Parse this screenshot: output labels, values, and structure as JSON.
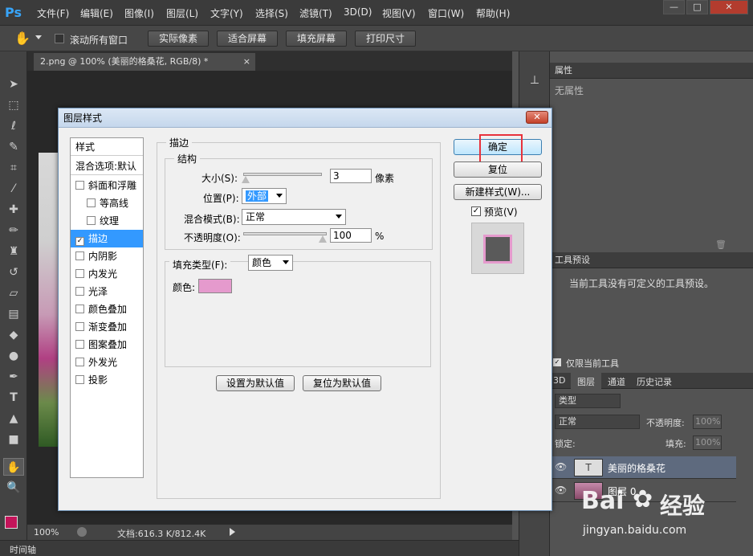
{
  "app": {
    "logo": "Ps"
  },
  "menu": [
    "文件(F)",
    "编辑(E)",
    "图像(I)",
    "图层(L)",
    "文字(Y)",
    "选择(S)",
    "滤镜(T)",
    "3D(D)",
    "视图(V)",
    "窗口(W)",
    "帮助(H)"
  ],
  "window_controls": [
    "—",
    "□",
    "✕"
  ],
  "options": {
    "scroll_all": "滚动所有窗口",
    "btn_actual": "实际像素",
    "btn_fit": "适合屏幕",
    "btn_fill": "填充屏幕",
    "btn_print": "打印尺寸"
  },
  "document": {
    "tab": "2.png @ 100% (美丽的格桑花, RGB/8) *",
    "close": "×"
  },
  "status": {
    "zoom": "100%",
    "doc": "文档:616.3 K/812.4K"
  },
  "timeline": "时间轴",
  "panels": {
    "properties": {
      "title": "属性",
      "content": "无属性"
    },
    "tool_presets": {
      "title": "工具预设",
      "content": "当前工具没有可定义的工具预设。",
      "current_only": "仅限当前工具"
    },
    "layers": {
      "tabs": [
        "3D",
        "图层",
        "通道",
        "历史记录"
      ],
      "filter": "类型",
      "blend": "正常",
      "opacity_label": "不透明度:",
      "opacity": "100%",
      "lock_label": "锁定:",
      "fill_label": "填充:",
      "fill": "100%",
      "items": [
        {
          "name": "美丽的格桑花",
          "thumb": "T"
        },
        {
          "name": "图层 0",
          "thumb": ""
        }
      ]
    }
  },
  "dialog": {
    "title": "图层样式",
    "close": "✕",
    "styles": [
      {
        "label": "样式",
        "checkbox": false,
        "checked": false,
        "indent": false,
        "selected": false
      },
      {
        "label": "混合选项:默认",
        "checkbox": false,
        "checked": false,
        "indent": false,
        "selected": false
      },
      {
        "label": "斜面和浮雕",
        "checkbox": true,
        "checked": false,
        "indent": false,
        "selected": false
      },
      {
        "label": "等高线",
        "checkbox": true,
        "checked": false,
        "indent": true,
        "selected": false
      },
      {
        "label": "纹理",
        "checkbox": true,
        "checked": false,
        "indent": true,
        "selected": false
      },
      {
        "label": "描边",
        "checkbox": true,
        "checked": true,
        "indent": false,
        "selected": true
      },
      {
        "label": "内阴影",
        "checkbox": true,
        "checked": false,
        "indent": false,
        "selected": false
      },
      {
        "label": "内发光",
        "checkbox": true,
        "checked": false,
        "indent": false,
        "selected": false
      },
      {
        "label": "光泽",
        "checkbox": true,
        "checked": false,
        "indent": false,
        "selected": false
      },
      {
        "label": "颜色叠加",
        "checkbox": true,
        "checked": false,
        "indent": false,
        "selected": false
      },
      {
        "label": "渐变叠加",
        "checkbox": true,
        "checked": false,
        "indent": false,
        "selected": false
      },
      {
        "label": "图案叠加",
        "checkbox": true,
        "checked": false,
        "indent": false,
        "selected": false
      },
      {
        "label": "外发光",
        "checkbox": true,
        "checked": false,
        "indent": false,
        "selected": false
      },
      {
        "label": "投影",
        "checkbox": true,
        "checked": false,
        "indent": false,
        "selected": false
      }
    ],
    "stroke": {
      "section": "描边",
      "structure": "结构",
      "size_label": "大小(S):",
      "size": "3",
      "size_unit": "像素",
      "size_level": 0.02,
      "position_label": "位置(P):",
      "position": "外部",
      "blend_label": "混合模式(B):",
      "blend": "正常",
      "opacity_label": "不透明度(O):",
      "opacity": "100",
      "opacity_unit": "%",
      "opacity_level": 1.0,
      "fill_type_label": "填充类型(F):",
      "fill_type": "颜色",
      "color_label": "颜色:",
      "color": "#e59acd",
      "btn_set_default": "设置为默认值",
      "btn_reset_default": "复位为默认值"
    },
    "buttons": {
      "ok": "确定",
      "reset": "复位",
      "new_style": "新建样式(W)...",
      "preview": "预览(V)"
    },
    "preview_checked": true,
    "accent": "#e8323c"
  },
  "watermark": {
    "brand": "Bai",
    "brand2": "经验",
    "url": "jingyan.baidu.com"
  },
  "colors": {
    "foreground": "#c4145a",
    "background": "#ffffff",
    "ps_blue": "#38a4f8"
  }
}
